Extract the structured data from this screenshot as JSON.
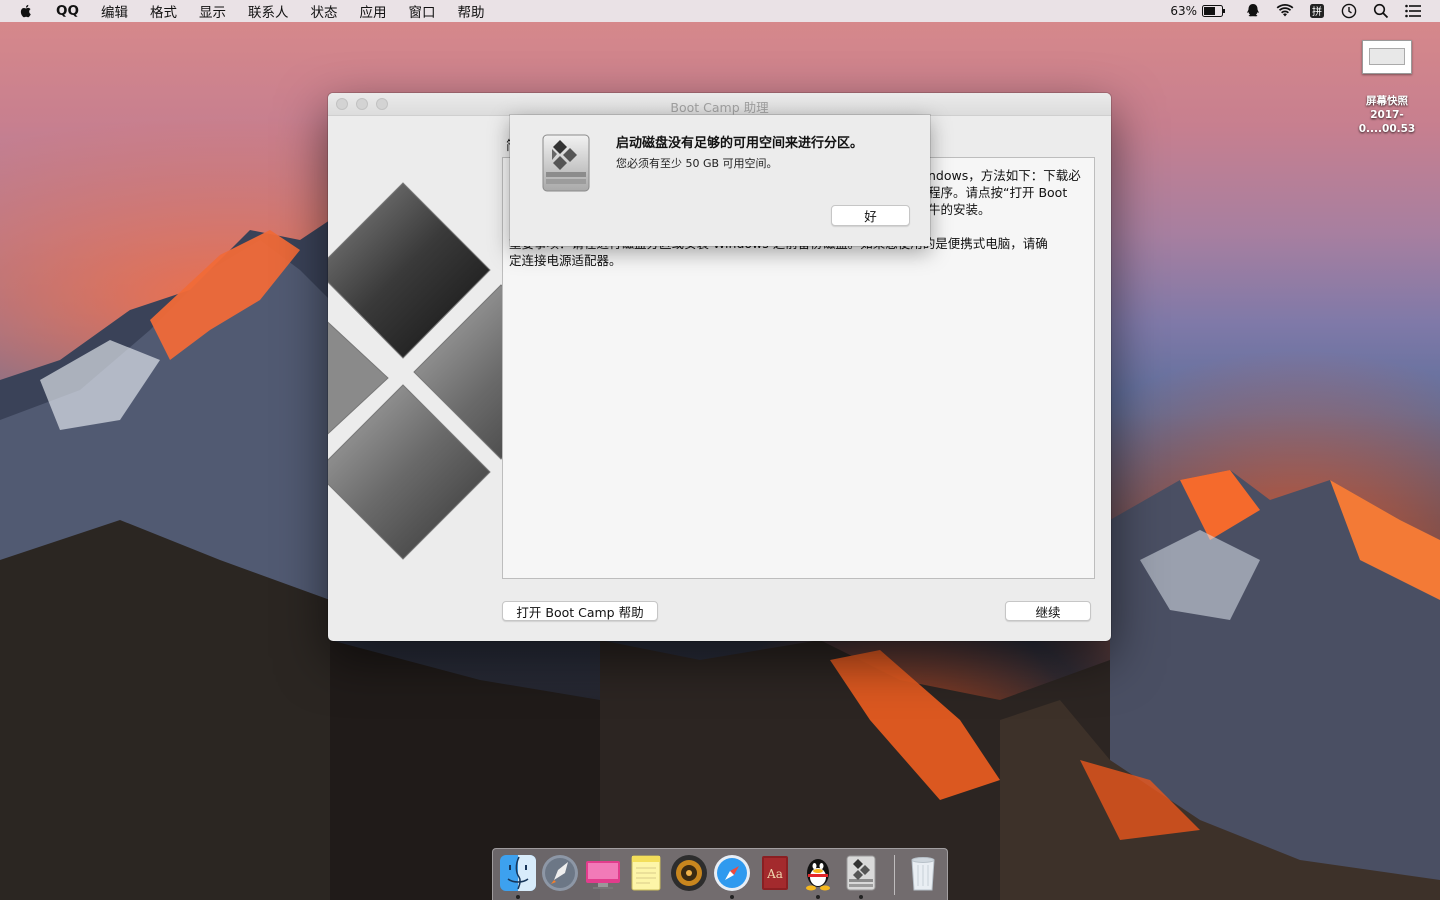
{
  "menubar": {
    "app_name": "QQ",
    "items": [
      "编辑",
      "格式",
      "显示",
      "联系人",
      "状态",
      "应用",
      "窗口",
      "帮助"
    ],
    "battery_percent": "63%"
  },
  "desktop": {
    "screenshot_file": {
      "title": "屏幕快照",
      "name": "2017-0....00.53"
    }
  },
  "window": {
    "title": "Boot Camp 助理",
    "heading_fragment": "简",
    "intro_lines": [
      "ndows，方法如下：下载必",
      "程序。请点按“打开 Boot",
      "牛的安装。"
    ],
    "note_lines": [
      "重要事项：请在进行磁盘分区或安装 Windows 之前备份磁盘。如果您使用的是便携式电脑，请确",
      "定连接电源适配器。"
    ],
    "help_button": "打开 Boot Camp 帮助",
    "continue_button": "继续"
  },
  "alert": {
    "message": "启动磁盘没有足够的可用空间来进行分区。",
    "informative": "您必须有至少 50 GB 可用空间。",
    "ok_button": "好"
  },
  "dock": {
    "apps": [
      "finder-icon",
      "launchpad-icon",
      "screen-sharing-icon",
      "notes-icon",
      "music-player-icon",
      "safari-icon",
      "dictionary-icon",
      "qq-icon",
      "bootcamp-icon",
      "trash-icon"
    ]
  }
}
